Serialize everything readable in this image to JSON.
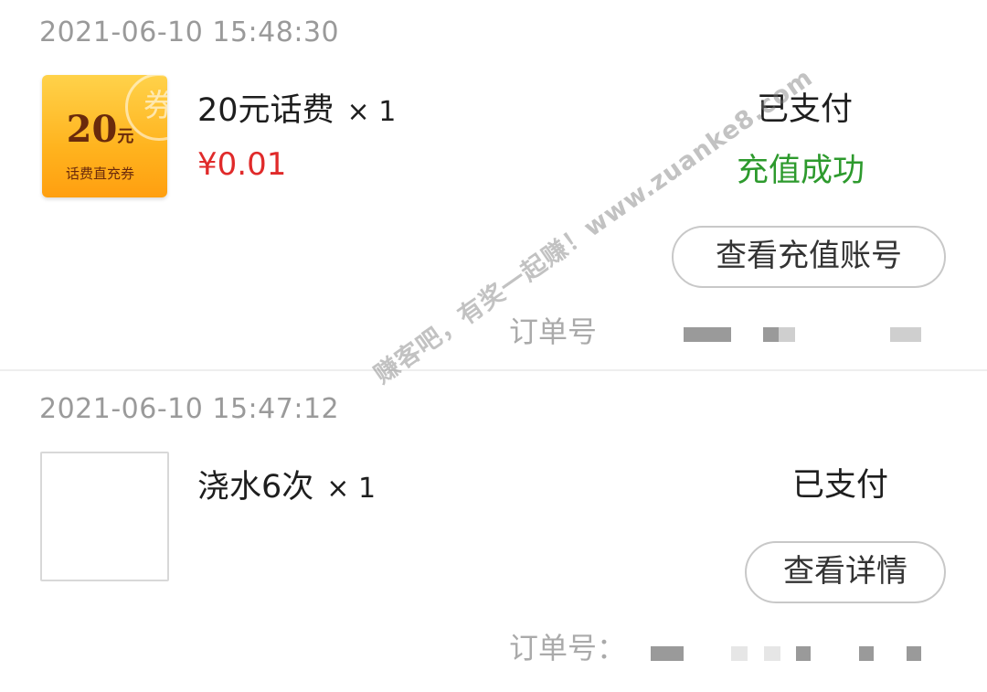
{
  "orders": [
    {
      "time": "2021-06-10 15:48:30",
      "thumbnail": {
        "amount": "20",
        "unit": "元",
        "desc": "话费直充券",
        "stamp": "券"
      },
      "product_name": "20元话费",
      "quantity": "× 1",
      "price": "¥0.01",
      "pay_status": "已支付",
      "recharge_status": "充值成功",
      "action_label": "查看充值账号",
      "order_no_label": "订单号"
    },
    {
      "time": "2021-06-10 15:47:12",
      "product_name": "浇水6次",
      "quantity": "× 1",
      "pay_status": "已支付",
      "action_label": "查看详情",
      "order_no_label": "订单号："
    }
  ],
  "watermark": "赚客吧，有奖一起赚！www.zuanke8.com",
  "colors": {
    "timestamp": "#9a9a9a",
    "price": "#e02a2a",
    "success": "#2d9a2d",
    "coupon_bg": "#ffb31e",
    "button_border": "#c8c8c8"
  }
}
